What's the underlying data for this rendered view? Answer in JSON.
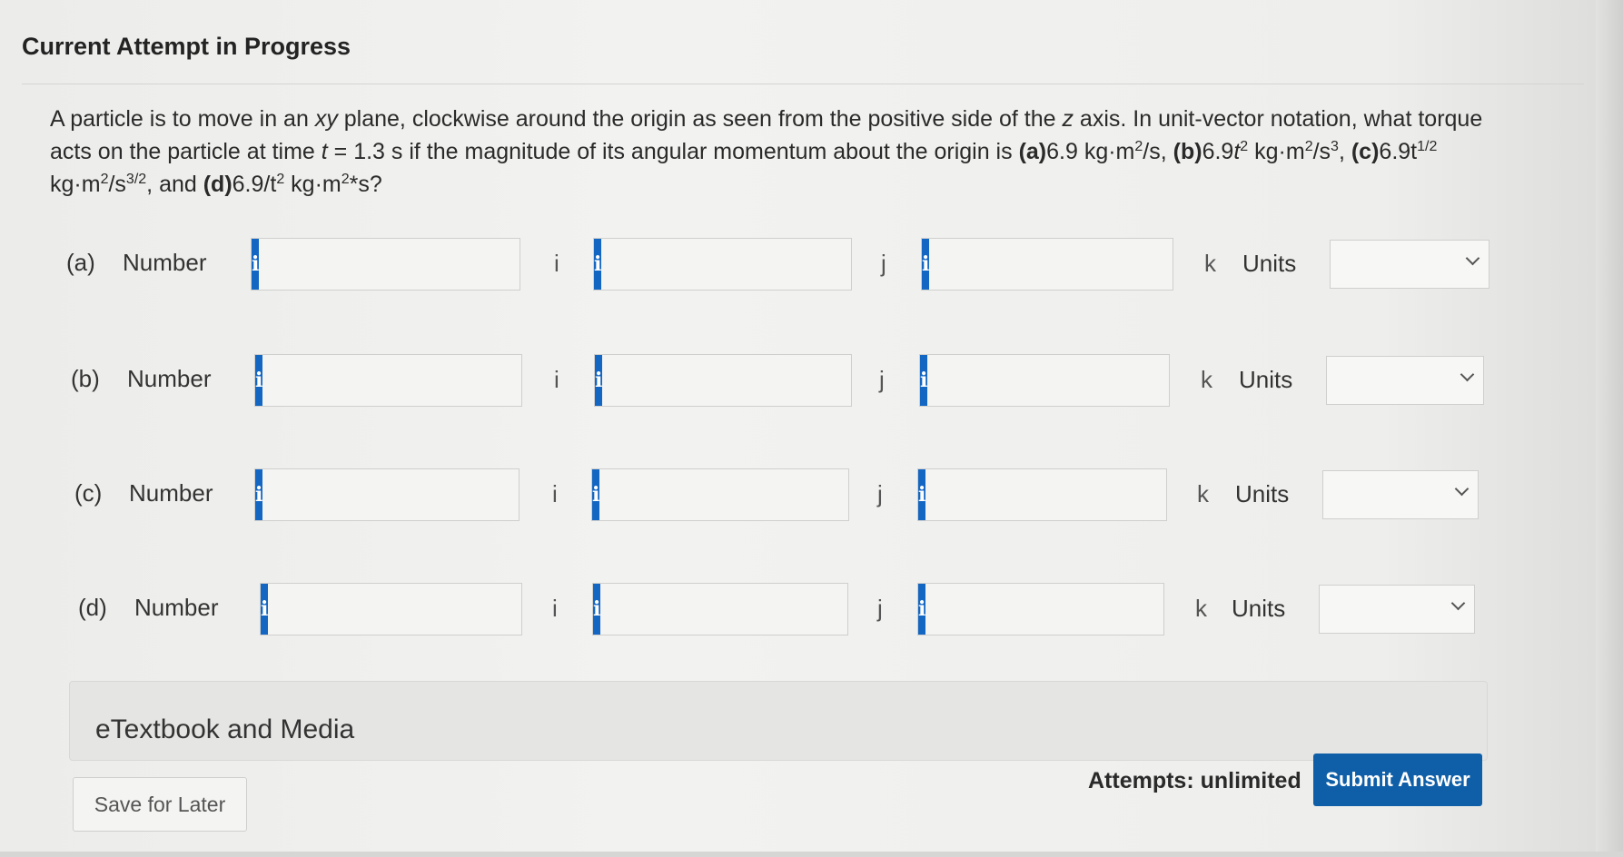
{
  "header": {
    "title": "Current Attempt in Progress"
  },
  "question": {
    "p1": "A particle is to move in an ",
    "xy": "xy",
    "p2": " plane, clockwise around the origin as seen from the positive side of the ",
    "z": "z",
    "p3": " axis. In unit-vector notation, what torque acts on the particle at time ",
    "t": "t",
    "p4": " = 1.3 s if the magnitude of its angular momentum about the origin is ",
    "a_label": "(a)",
    "a_val": "6.9 kg·m",
    "a_exp1": "2",
    "a_tail": "/s, ",
    "b_label": "(b)",
    "b_val": "6.9",
    "b_t": "t",
    "b_exp1": "2",
    "b_unit": " kg·m",
    "b_exp2": "2",
    "b_unit2": "/s",
    "b_exp3": "3",
    "b_tail": ", ",
    "c_label": "(c)",
    "c_val": "6.9t",
    "c_exp1": "1/2",
    "c_unit": " kg·m",
    "c_exp2": "2",
    "c_unit2": "/s",
    "c_exp3": "3/2",
    "c_tail": ", and ",
    "d_label": "(d)",
    "d_val": "6.9/t",
    "d_exp1": "2",
    "d_unit": " kg·m",
    "d_exp2": "2",
    "d_tail": "*s?"
  },
  "rows": [
    {
      "part": "(a)",
      "number_label": "Number",
      "i": "i",
      "j": "j",
      "k": "k",
      "units_label": "Units",
      "info": "i"
    },
    {
      "part": "(b)",
      "number_label": "Number",
      "i": "i",
      "j": "j",
      "k": "k",
      "units_label": "Units",
      "info": "i"
    },
    {
      "part": "(c)",
      "number_label": "Number",
      "i": "i",
      "j": "j",
      "k": "k",
      "units_label": "Units",
      "info": "i"
    },
    {
      "part": "(d)",
      "number_label": "Number",
      "i": "i",
      "j": "j",
      "k": "k",
      "units_label": "Units",
      "info": "i"
    }
  ],
  "media": {
    "label": "eTextbook and Media"
  },
  "footer": {
    "save_label": "Save for Later",
    "attempts": "Attempts: unlimited",
    "submit_label": "Submit Answer"
  },
  "colors": {
    "accent": "#1366c2",
    "submit": "#0e5fa8"
  }
}
